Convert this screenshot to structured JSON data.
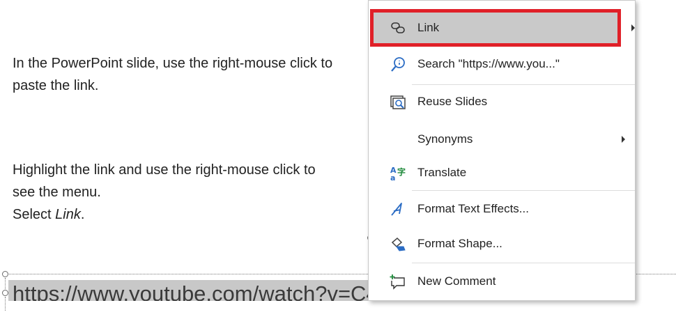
{
  "instructions": {
    "paragraph1": "In the PowerPoint slide, use the right-mouse click to paste the link.",
    "paragraph2_line": "Highlight the link and use the right-mouse click to see the menu.",
    "paragraph2_select": "Select ",
    "paragraph2_select_item": "Link",
    "paragraph2_period": "."
  },
  "slide": {
    "url_text": "https://www.youtube.com/watch?v=C41o5a6NeNE"
  },
  "context_menu": {
    "items": [
      {
        "label": "Link",
        "icon": "link-icon",
        "has_submenu": true,
        "highlighted": true
      },
      {
        "label": "Search \"https://www.you...\"",
        "icon": "search-icon",
        "has_submenu": false
      },
      {
        "label": "Reuse Slides",
        "icon": "reuse-slides-icon",
        "has_submenu": false
      },
      {
        "label": "Synonyms",
        "icon": "",
        "has_submenu": true
      },
      {
        "label": "Translate",
        "icon": "translate-icon",
        "has_submenu": false
      },
      {
        "label": "Format Text Effects...",
        "icon": "text-effects-icon",
        "has_submenu": false
      },
      {
        "label": "Format Shape...",
        "icon": "format-shape-icon",
        "has_submenu": false
      },
      {
        "label": "New Comment",
        "icon": "new-comment-icon",
        "has_submenu": false
      }
    ]
  },
  "colors": {
    "highlight_border": "#e02028",
    "menu_hover": "#c9c9c9",
    "selection_gray": "#c8c8c8",
    "icon_blue": "#2b6cc4",
    "icon_green": "#1f8a3b"
  }
}
